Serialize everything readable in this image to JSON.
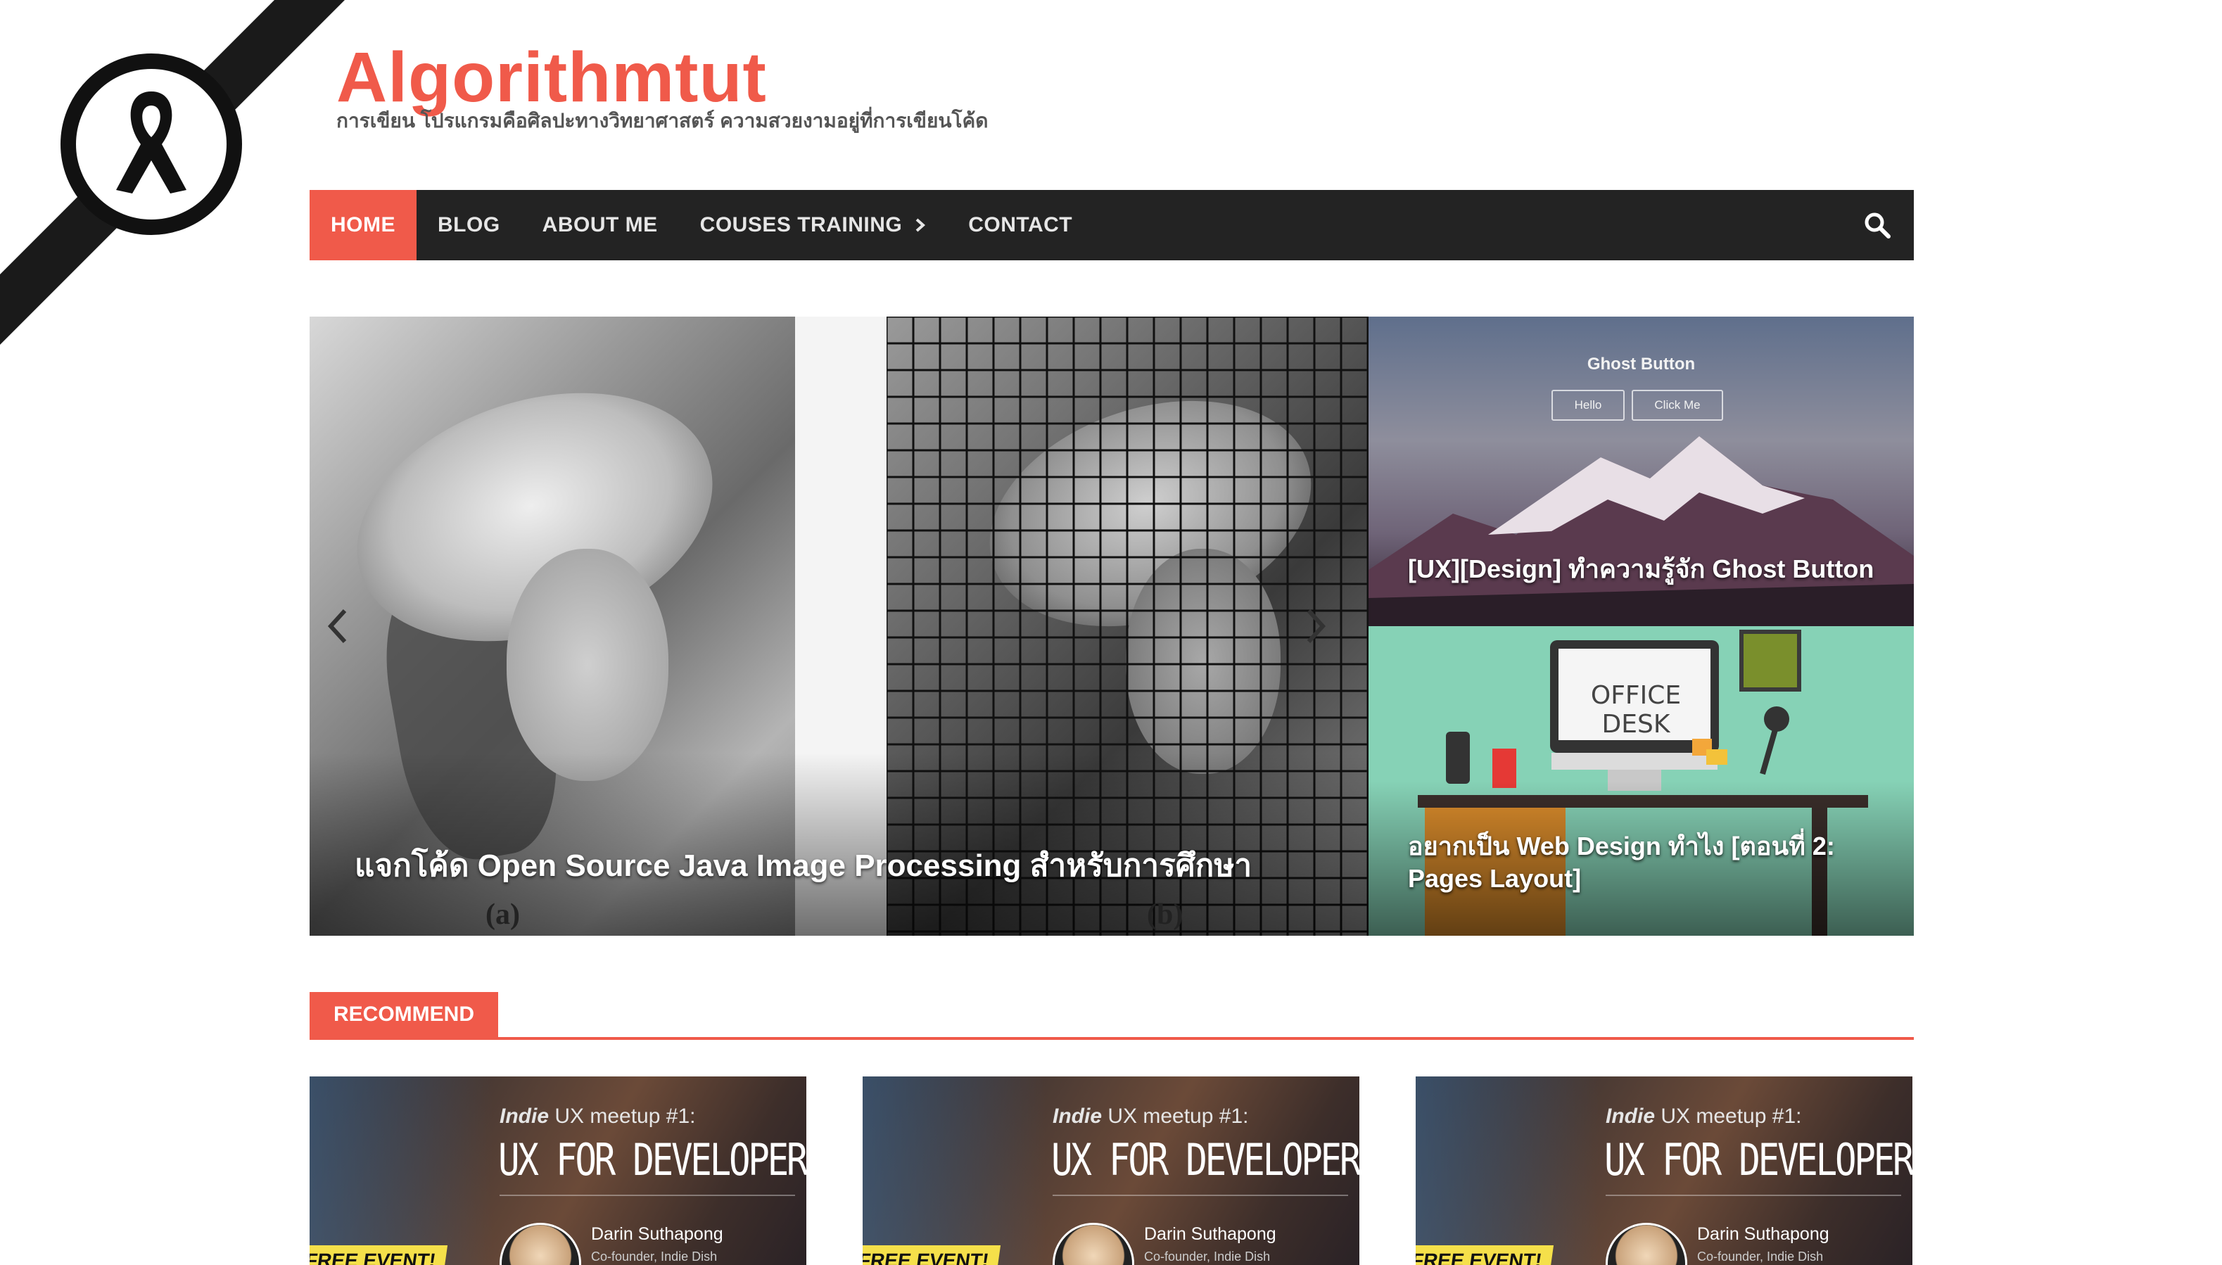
{
  "site": {
    "title": "Algorithmtut",
    "tagline": "การเขียน โปรแกรมคือศิลปะทางวิทยาศาสตร์ ความสวยงามอยู่ที่การเขียนโค้ด"
  },
  "nav": {
    "items": [
      {
        "label": "HOME",
        "active": true
      },
      {
        "label": "BLOG",
        "active": false
      },
      {
        "label": "ABOUT ME",
        "active": false
      },
      {
        "label": "COUSES TRAINING",
        "active": false,
        "has_submenu": true
      },
      {
        "label": "CONTACT",
        "active": false
      }
    ],
    "search_icon": "search-icon"
  },
  "slider": {
    "caption": "แจกโค้ด Open Source Java Image Processing สำหรับการศึกษา",
    "sub_label_a": "(a)",
    "sub_label_b": "(b)"
  },
  "featured_posts": [
    {
      "image_heading": "Ghost Button",
      "image_button_1": "Hello",
      "image_button_2": "Click Me",
      "caption": "[UX][Design] ทำความรู้จัก Ghost Button"
    },
    {
      "image_heading": "OFFICE DESK",
      "caption": "อยากเป็น Web Design ทำไง [ตอนที่ 2: Pages Layout]"
    }
  ],
  "recommend": {
    "label": "RECOMMEND",
    "cards": [
      {
        "sub_prefix": "Indie",
        "sub_rest": " UX meetup #1:",
        "title": "UX FOR DEVELOPERS",
        "speaker": "Darin Suthapong",
        "role": "Co-founder, Indie Dish",
        "badge": "FREE EVENT!"
      },
      {
        "sub_prefix": "Indie",
        "sub_rest": " UX meetup #1:",
        "title": "UX FOR DEVELOPERS",
        "speaker": "Darin Suthapong",
        "role": "Co-founder, Indie Dish",
        "badge": "FREE EVENT!"
      },
      {
        "sub_prefix": "Indie",
        "sub_rest": " UX meetup #1:",
        "title": "UX FOR DEVELOPERS",
        "speaker": "Darin Suthapong",
        "role": "Co-founder, Indie Dish",
        "badge": "FREE EVENT!"
      }
    ]
  },
  "colors": {
    "accent": "#f05a4a",
    "nav_bg": "#232323"
  }
}
